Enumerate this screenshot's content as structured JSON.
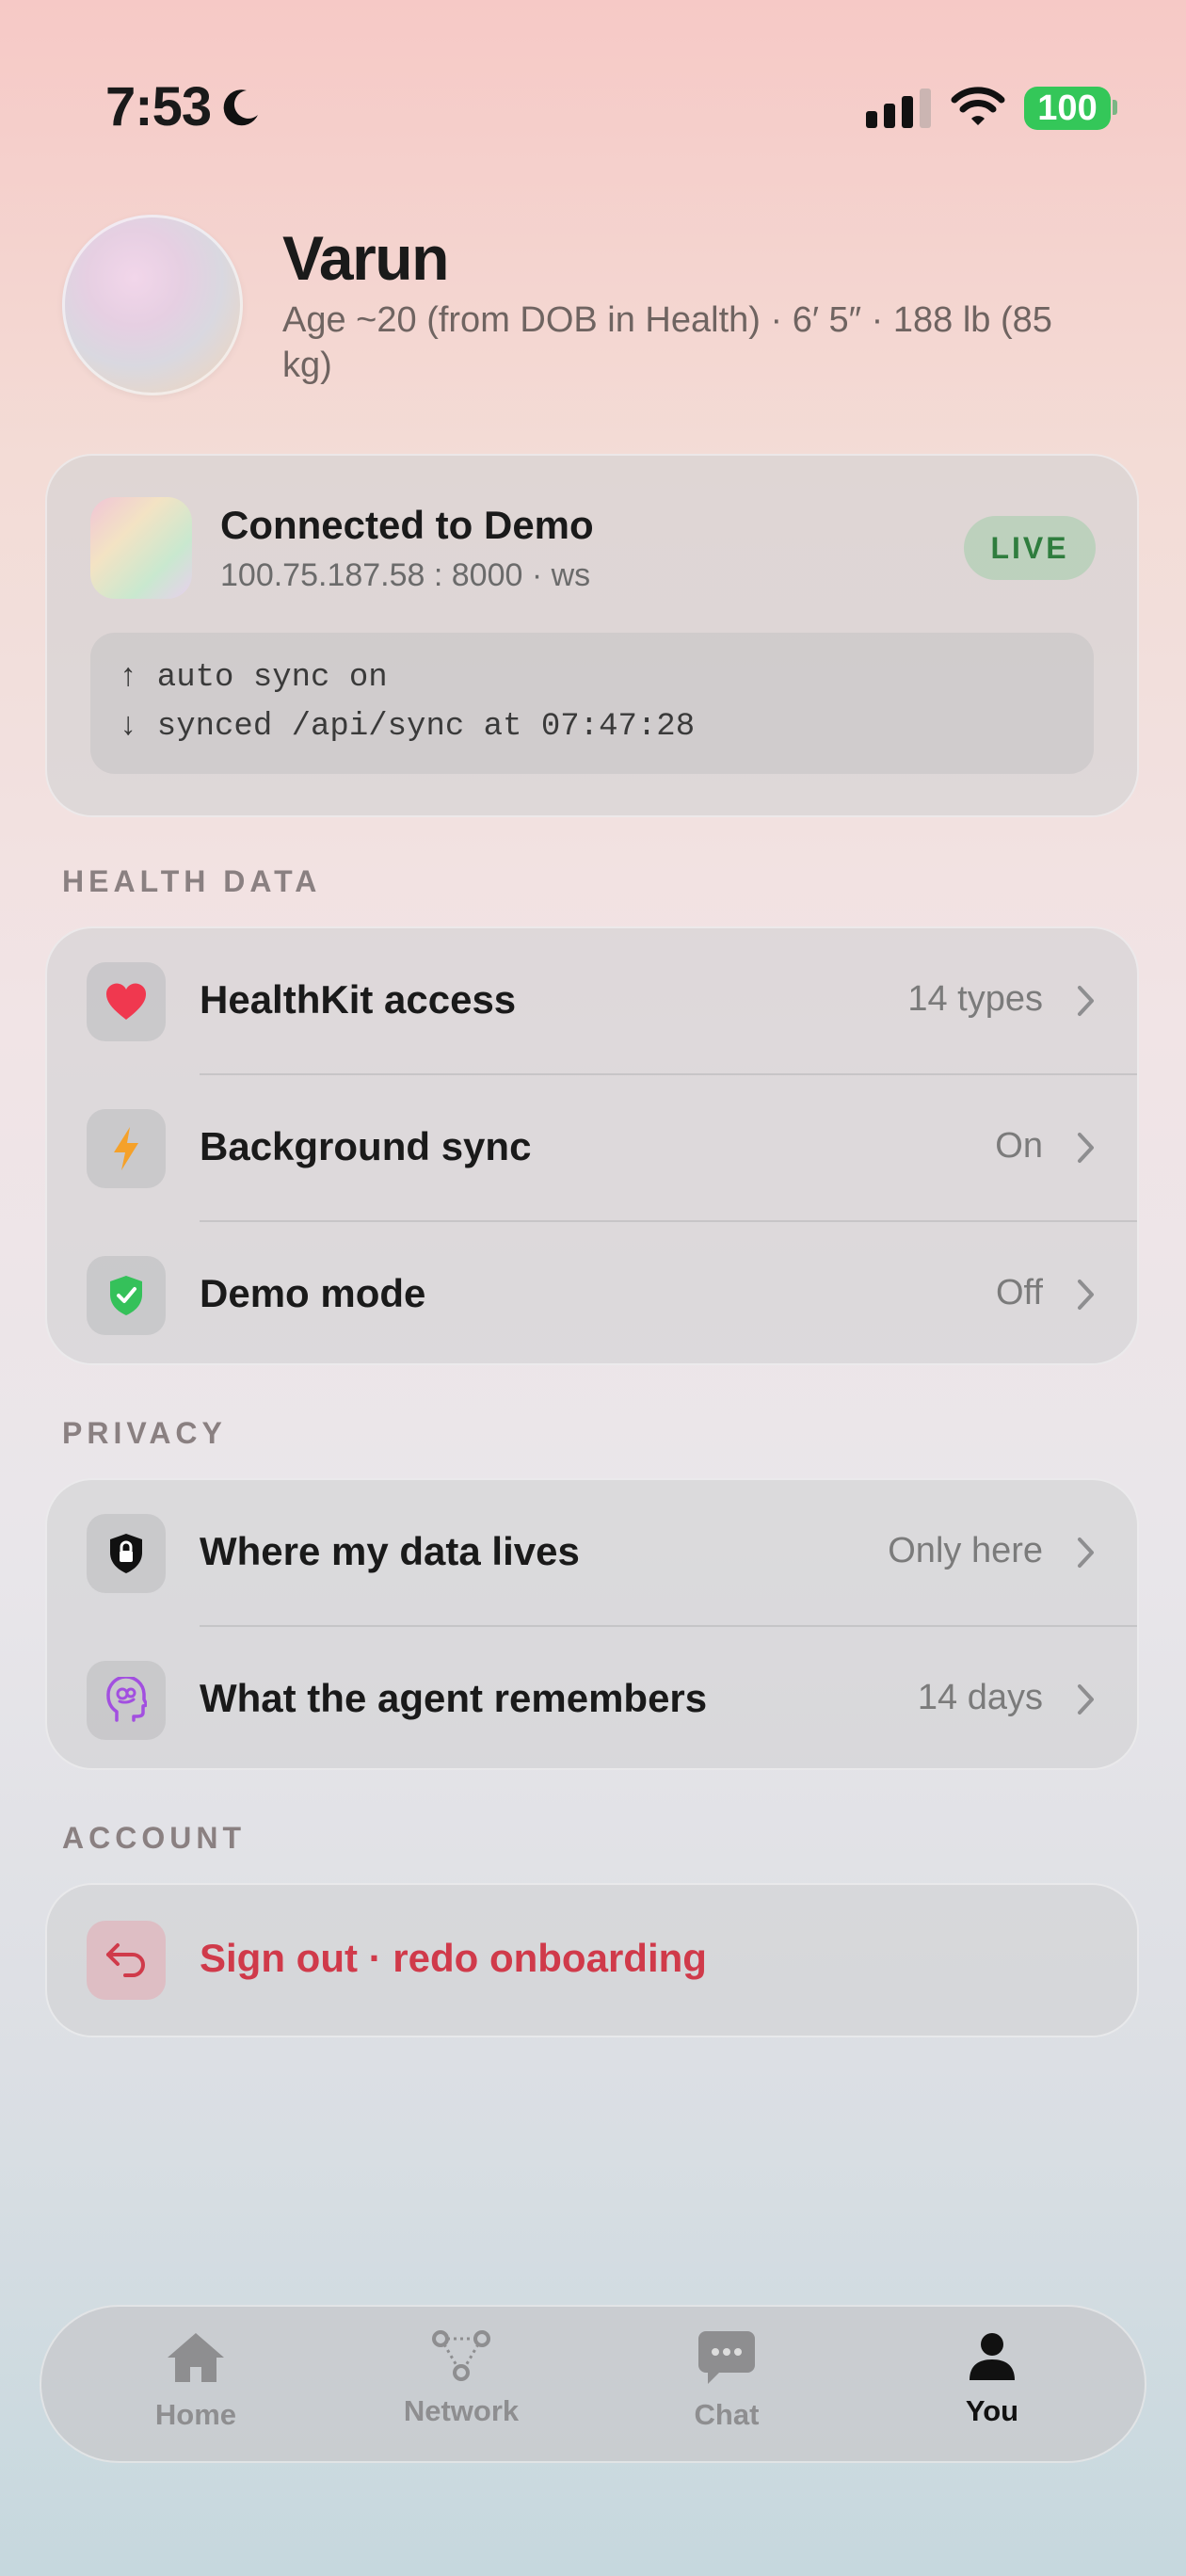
{
  "status_bar": {
    "time": "7:53",
    "battery": "100"
  },
  "profile": {
    "name": "Varun",
    "details": "Age ~20 (from DOB in Health) · 6′ 5″ · 188 lb (85 kg)"
  },
  "connection": {
    "title": "Connected to Demo",
    "address": "100.75.187.58 : 8000 · ws",
    "badge": "LIVE",
    "log": [
      "↑ auto sync on",
      "↓ synced /api/sync at 07:47:28"
    ]
  },
  "sections": {
    "health": {
      "header": "HEALTH DATA",
      "rows": [
        {
          "label": "HealthKit access",
          "value": "14 types",
          "icon": "heart-icon"
        },
        {
          "label": "Background sync",
          "value": "On",
          "icon": "bolt-icon"
        },
        {
          "label": "Demo mode",
          "value": "Off",
          "icon": "shield-check-icon"
        }
      ]
    },
    "privacy": {
      "header": "PRIVACY",
      "rows": [
        {
          "label": "Where my data lives",
          "value": "Only here",
          "icon": "lock-shield-icon"
        },
        {
          "label": "What the agent remembers",
          "value": "14 days",
          "icon": "brain-head-icon"
        }
      ]
    },
    "account": {
      "header": "ACCOUNT",
      "rows": [
        {
          "label": "Sign out · redo onboarding",
          "icon": "return-arrow-icon"
        }
      ]
    }
  },
  "tab_bar": {
    "tabs": [
      {
        "label": "Home",
        "icon": "house-icon"
      },
      {
        "label": "Network",
        "icon": "network-icon"
      },
      {
        "label": "Chat",
        "icon": "chat-bubble-icon"
      },
      {
        "label": "You",
        "icon": "person-icon"
      }
    ],
    "active": "You"
  },
  "colors": {
    "accent_red": "#d03a4a",
    "live_green": "#2f7d3e",
    "battery_green": "#34c759"
  }
}
